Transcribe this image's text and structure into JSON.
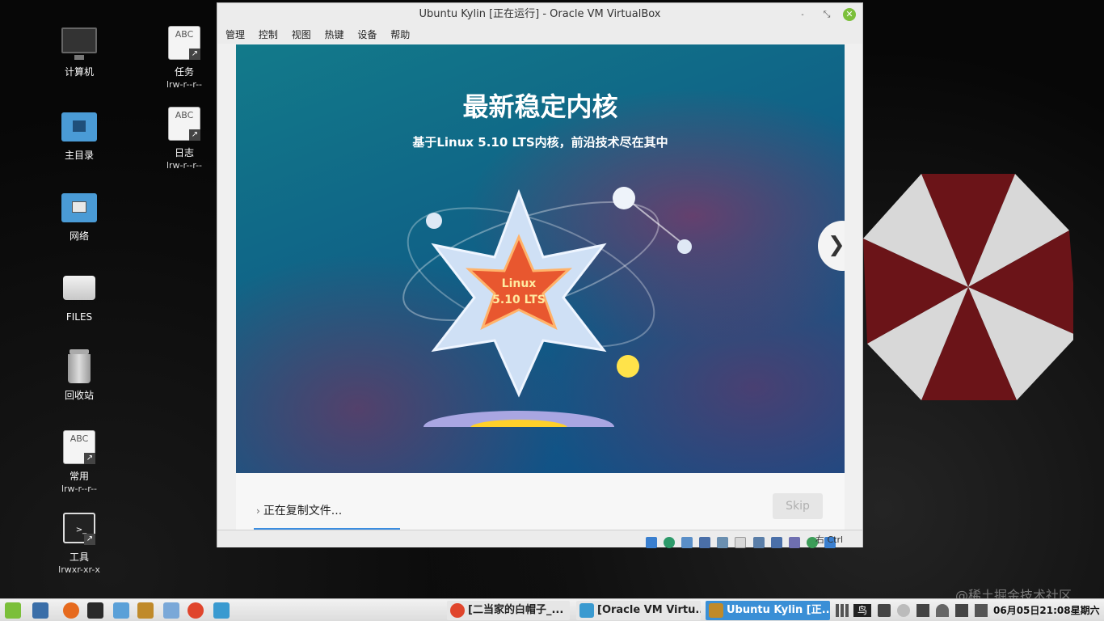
{
  "desktop": {
    "icons": [
      {
        "label": "计算机",
        "sub": ""
      },
      {
        "label": "任务",
        "sub": "lrw-r--r--"
      },
      {
        "label": "主目录",
        "sub": ""
      },
      {
        "label": "日志",
        "sub": "lrw-r--r--"
      },
      {
        "label": "网络",
        "sub": ""
      },
      {
        "label": "FILES",
        "sub": ""
      },
      {
        "label": "回收站",
        "sub": ""
      },
      {
        "label": "常用",
        "sub": "lrw-r--r--"
      },
      {
        "label": "工具",
        "sub": "lrwxr-xr-x"
      }
    ],
    "doc_icon_text": "ABC"
  },
  "vbox": {
    "title": "Ubuntu Kylin [正在运行] - Oracle VM VirtualBox",
    "menu": [
      "管理",
      "控制",
      "视图",
      "热键",
      "设备",
      "帮助"
    ],
    "host_key": "右 Ctrl"
  },
  "installer": {
    "slide_title": "最新稳定内核",
    "slide_subtitle": "基于Linux 5.10 LTS内核，前沿技术尽在其中",
    "badge_line1": "Linux",
    "badge_line2": "5.10 LTS",
    "status": "正在复制文件...",
    "skip_label": "Skip",
    "progress_fraction": 0.24
  },
  "watermark": "@稀土掘金技术社区",
  "taskbar": {
    "windows": [
      {
        "label": "[二当家的白帽子_..."
      },
      {
        "label": "[Oracle VM Virtu..."
      },
      {
        "label": "Ubuntu Kylin [正..."
      }
    ],
    "input_method": "鸟",
    "clock": "06月05日21:08星期六"
  },
  "colors": {
    "slide_bg": "#0f5c86",
    "progress": "#3b8de0",
    "active_task": "#3a8fd6",
    "mint_green": "#7bbf3a"
  }
}
